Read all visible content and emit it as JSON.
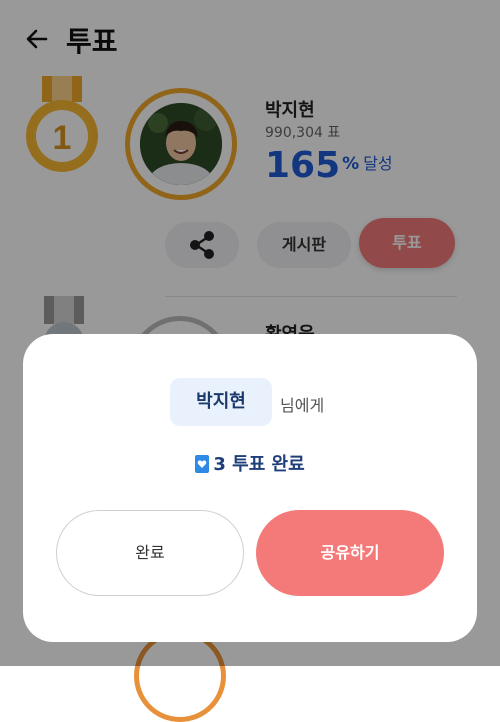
{
  "header": {
    "title": "투표"
  },
  "first_candidate": {
    "rank": "1",
    "name": "박지현",
    "votes": "990,304 표",
    "percent": "165",
    "percent_unit": "%",
    "percent_label": "달성",
    "board_label": "게시판",
    "vote_label": "투표"
  },
  "second_candidate": {
    "name": "황영웅"
  },
  "modal": {
    "recipient": "박지현",
    "recipient_suffix": "님에게",
    "vote_count": "3",
    "done_text": "투표 완료",
    "complete_label": "완료",
    "share_label": "공유하기"
  },
  "colors": {
    "accent_blue": "#1e5bd4",
    "vote_pink": "#f47a7a",
    "gold": "#f0a92a"
  },
  "icons": [
    "back-arrow-icon",
    "gold-medal-icon",
    "share-icon",
    "silver-medal-icon",
    "heart-ticket-icon"
  ]
}
